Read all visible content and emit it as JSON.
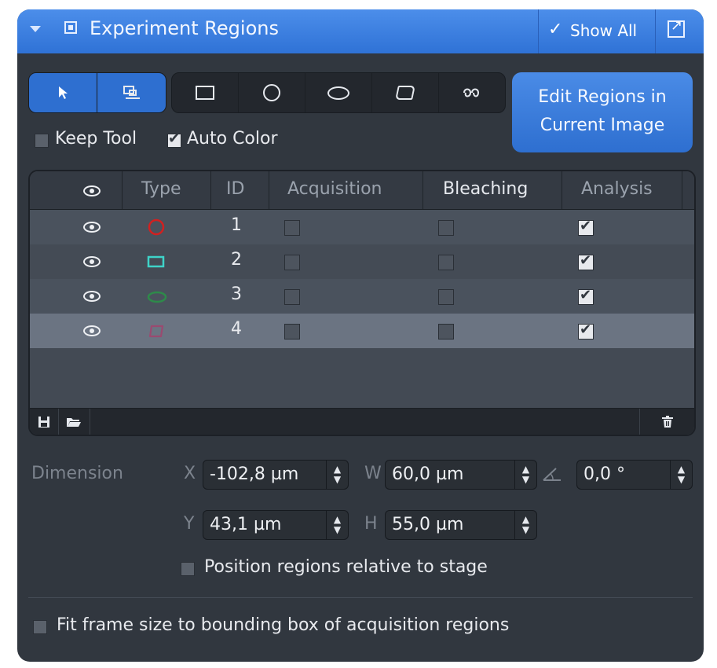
{
  "panel": {
    "title": "Experiment Regions",
    "show_all_label": "Show All"
  },
  "tools": {
    "edit_button_line1": "Edit Regions in",
    "edit_button_line2": "Current Image"
  },
  "options": {
    "keep_tool_label": "Keep Tool",
    "auto_color_label": "Auto Color"
  },
  "table": {
    "headers": [
      "Type",
      "ID",
      "Acquisition",
      "Bleaching",
      "Analysis"
    ],
    "rows": [
      {
        "id": "1",
        "shape": "circle",
        "color": "#d22020",
        "acquisition": false,
        "bleaching": false,
        "analysis": true
      },
      {
        "id": "2",
        "shape": "rectangle",
        "color": "#3ed3c8",
        "acquisition": false,
        "bleaching": false,
        "analysis": true
      },
      {
        "id": "3",
        "shape": "ellipse",
        "color": "#2e8a4a",
        "acquisition": false,
        "bleaching": false,
        "analysis": true
      },
      {
        "id": "4",
        "shape": "polygon",
        "color": "#9a4a70",
        "acquisition": false,
        "bleaching": false,
        "analysis": true
      }
    ]
  },
  "dimension": {
    "label": "Dimension",
    "x_label": "X",
    "x_value": "-102,8 µm",
    "w_label": "W",
    "w_value": "60,0 µm",
    "angle_value": "0,0 °",
    "y_label": "Y",
    "y_value": "43,1 µm",
    "h_label": "H",
    "h_value": "55,0 µm",
    "relative_label": "Position regions relative to stage"
  },
  "fit": {
    "label": "Fit frame size to bounding box of acquisition regions"
  }
}
